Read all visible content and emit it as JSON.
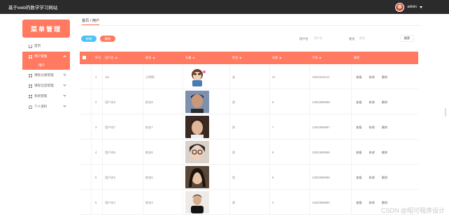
{
  "header": {
    "site_title": "基于web的数学学习网站",
    "user_name": "admin",
    "avatar_icon": "user-avatar-icon",
    "dropdown_icon": "caret-down-icon"
  },
  "sidebar": {
    "title": "菜单管理",
    "items": [
      {
        "label": "首页",
        "icon": "home-icon"
      },
      {
        "label": "用户管理",
        "icon": "grid-icon",
        "children": [
          {
            "label": "用户"
          }
        ]
      },
      {
        "label": "课程分类管理",
        "icon": "grid-icon"
      },
      {
        "label": "课程信息管理",
        "icon": "grid-icon"
      },
      {
        "label": "系统管理",
        "icon": "grid-icon"
      },
      {
        "label": "个人资料",
        "icon": "user-icon"
      }
    ]
  },
  "breadcrumb": "首页 / 用户",
  "toolbar": {
    "add_label": "新增",
    "delete_label": "删除",
    "search_fields": [
      {
        "label": "用户名",
        "placeholder": "用户名"
      },
      {
        "label": "姓名",
        "placeholder": "姓名"
      }
    ],
    "search_label": "搜索"
  },
  "table": {
    "columns": [
      "序号",
      "用户名",
      "姓名",
      "头像",
      "性别",
      "年龄",
      "手机",
      "操作"
    ],
    "actions": [
      "查看",
      "修改",
      "删除"
    ],
    "rows": [
      {
        "index": "1",
        "username": "111",
        "name": "小明啊",
        "avatar": "cartoon",
        "gender": "女",
        "age": "21",
        "phone": "13544515121"
      },
      {
        "index": "2",
        "username": "用户名8",
        "name": "姓名8",
        "avatar": "photo",
        "gender": "男",
        "age": "8",
        "phone": "13823888888"
      },
      {
        "index": "3",
        "username": "用户名7",
        "name": "姓名7",
        "avatar": "photo",
        "gender": "男",
        "age": "7",
        "phone": "13823888887"
      },
      {
        "index": "4",
        "username": "用户名6",
        "name": "姓名6",
        "avatar": "photo",
        "gender": "男",
        "age": "6",
        "phone": "13823888886"
      },
      {
        "index": "5",
        "username": "用户名5",
        "name": "姓名5",
        "avatar": "photo",
        "gender": "男",
        "age": "5",
        "phone": "13823888885"
      },
      {
        "index": "6",
        "username": "用户名4",
        "name": "姓名4",
        "avatar": "photo",
        "gender": "男",
        "age": "4",
        "phone": "13823888884"
      }
    ]
  },
  "watermark": "CSDN @昭可程序设计",
  "colors": {
    "accent": "#ff7a60",
    "add_button": "#4fc2f8",
    "topbar": "#2b2b2b"
  }
}
